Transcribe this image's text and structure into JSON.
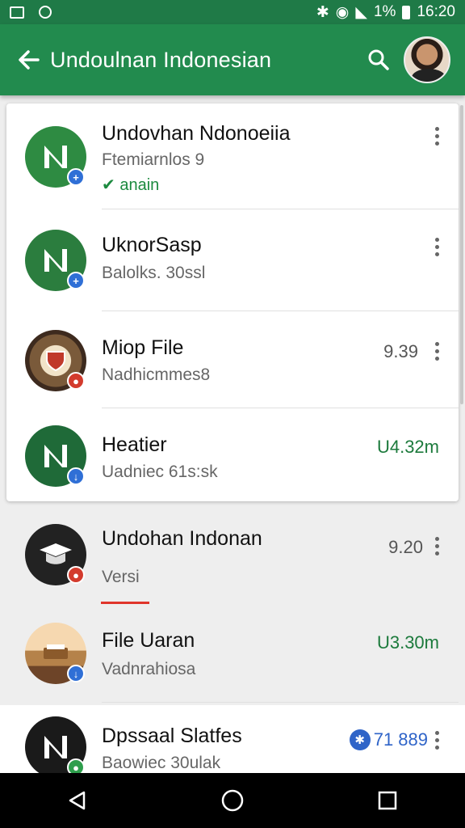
{
  "status_bar": {
    "battery": "1%",
    "time": "16:20"
  },
  "app_bar": {
    "title": "Undoulnan Indonesian"
  },
  "items": [
    {
      "title": "Undovhan Ndonoeiia",
      "subtitle": "Ftemiarnlos 9",
      "status": "anain",
      "meta": ""
    },
    {
      "title": "UknorSasp",
      "subtitle": "Balolks. 30ssl",
      "meta": ""
    },
    {
      "title": "Miop File",
      "subtitle": "Nadhicmmes8",
      "meta": "9.39"
    },
    {
      "title": "Heatier",
      "subtitle": "Uadniec 61s:sk",
      "meta": "U4.32m"
    },
    {
      "title": "Undohan Indonan",
      "subtitle": "Versi",
      "meta": "9.20"
    },
    {
      "title": "File Uaran",
      "subtitle": "Vadnrahiosa",
      "meta": "U3.30m"
    },
    {
      "title": "Dpssaal Slatfes",
      "subtitle": "Baowiec 30ulak",
      "meta": "71 889"
    }
  ],
  "colors": {
    "app_bar": "#228b4e",
    "status_bar": "#1f7a47",
    "accent": "#e0352b",
    "meta_green": "#1c7a3c"
  }
}
